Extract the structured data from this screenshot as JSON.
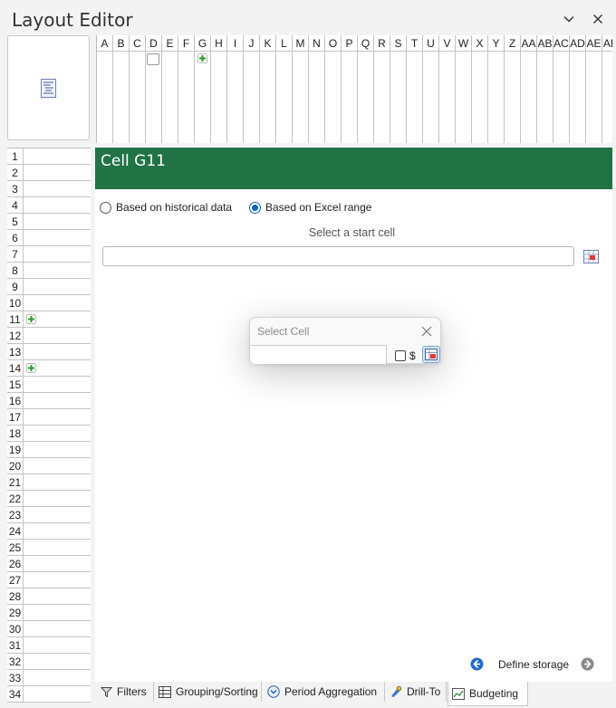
{
  "window": {
    "title": "Layout Editor"
  },
  "columns": [
    "A",
    "B",
    "C",
    "D",
    "E",
    "F",
    "G",
    "H",
    "I",
    "J",
    "K",
    "L",
    "M",
    "N",
    "O",
    "P",
    "Q",
    "R",
    "S",
    "T",
    "U",
    "V",
    "W",
    "X",
    "Y",
    "Z",
    "AA",
    "AB",
    "AC",
    "AD",
    "AE",
    "AF"
  ],
  "rows": [
    "1",
    "2",
    "3",
    "4",
    "5",
    "6",
    "7",
    "8",
    "9",
    "10",
    "11",
    "12",
    "13",
    "14",
    "15",
    "16",
    "17",
    "18",
    "19",
    "20",
    "21",
    "22",
    "23",
    "24",
    "25",
    "26",
    "27",
    "28",
    "29",
    "30",
    "31",
    "32",
    "33",
    "34"
  ],
  "panel": {
    "title": "Cell G11",
    "radio_historical": "Based on historical data",
    "radio_excel": "Based on Excel range",
    "selected_option": "Based on Excel range",
    "start_cell_hint": "Select a start cell",
    "range_value": "",
    "define_storage": "Define storage"
  },
  "popup": {
    "title": "Select Cell",
    "input_value": "",
    "absolute_label": "$",
    "absolute_checked": false
  },
  "tabs": [
    {
      "label": "Filters",
      "icon": "funnel-icon"
    },
    {
      "label": "Grouping/Sorting",
      "icon": "grid-icon"
    },
    {
      "label": "Period Aggregation",
      "icon": "chevron-circle-icon"
    },
    {
      "label": "Drill-To",
      "icon": "pointer-icon"
    },
    {
      "label": "Budgeting",
      "icon": "chart-icon",
      "active": true
    }
  ],
  "colors": {
    "header_green": "#217346",
    "accent_blue": "#0a63c9",
    "plus_green": "#2a9d2a"
  }
}
